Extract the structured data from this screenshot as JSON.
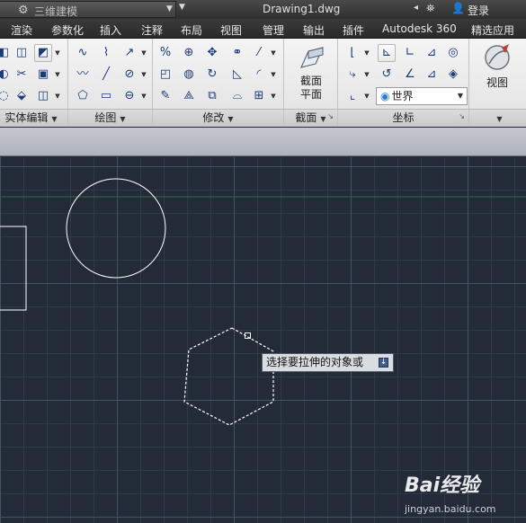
{
  "titlebar": {
    "workspace": "三维建模",
    "document": "Drawing1.dwg",
    "login": "登录"
  },
  "tabs": [
    "渲染",
    "参数化",
    "插入",
    "注释",
    "布局",
    "视图",
    "管理",
    "输出",
    "插件",
    "Autodesk 360",
    "精选应用"
  ],
  "panels": {
    "solid_edit": "实体编辑",
    "draw": "绘图",
    "modify": "修改",
    "section": "截面",
    "coordinates": "坐标",
    "view": "视图"
  },
  "section_button": {
    "line1": "截面",
    "line2": "平面"
  },
  "view_button": "视图",
  "coord_select": "世界",
  "tooltip": "选择要拉伸的对象或",
  "watermark": {
    "logo": "Bai经验",
    "url": "jingyan.baidu.com"
  },
  "colors": {
    "canvas": "#232b38",
    "ucs_line": "#2f6b3a",
    "geometry": "#ffffff"
  }
}
